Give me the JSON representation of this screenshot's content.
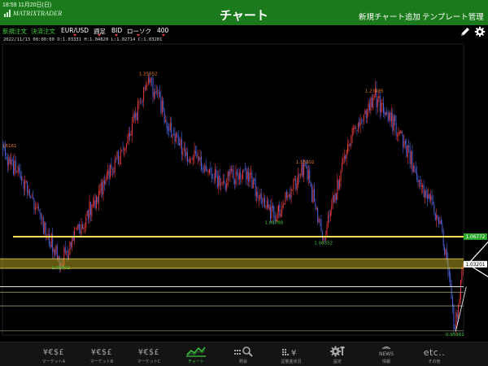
{
  "status_bar": {
    "time": "18:59",
    "date": "11月20日(日)"
  },
  "header": {
    "logo_text": "MATRIXTRADER",
    "title": "チャート",
    "new_chart_label": "新規チャート追加",
    "template_label": "テンプレート管理"
  },
  "toolbar": {
    "new_order_label": "新規注文",
    "settle_order_label": "決済注文",
    "symbol": "EUR/USD",
    "timeframe": "週足",
    "price_side": "BID",
    "chart_type": "ローソク",
    "bar_count": "400",
    "pencil_icon": "pencil-icon",
    "gear_icon": "gear-icon"
  },
  "ohlc_readout": {
    "datetime": "2022/11/13 00:00:00",
    "open": "O:1.03331",
    "high": "H:1.04820",
    "low": "L:1.02714",
    "close": "C:1.03201"
  },
  "chart_data": {
    "type": "candlestick",
    "symbol": "EUR/USD",
    "timeframe": "週足",
    "bar_count": 400,
    "ylim": [
      0.947,
      1.296
    ],
    "bull_color": "#e83a3a",
    "bear_color": "#4a64d8",
    "swing_points": [
      {
        "i": 0,
        "price": 1.17,
        "label": ""
      },
      {
        "i": 22,
        "price": 1.12,
        "label": ""
      },
      {
        "i": 50,
        "price": 1.034,
        "label": "1.03402"
      },
      {
        "i": 68,
        "price": 1.08,
        "label": ""
      },
      {
        "i": 108,
        "price": 1.18,
        "label": ""
      },
      {
        "i": 126,
        "price": 1.2555,
        "label": "1.25552"
      },
      {
        "i": 152,
        "price": 1.175,
        "label": ""
      },
      {
        "i": 190,
        "price": 1.13,
        "label": ""
      },
      {
        "i": 210,
        "price": 1.145,
        "label": ""
      },
      {
        "i": 235,
        "price": 1.0879,
        "label": "1.08788"
      },
      {
        "i": 262,
        "price": 1.15,
        "label": "1.15002"
      },
      {
        "i": 278,
        "price": 1.0634,
        "label": "1.06352"
      },
      {
        "i": 302,
        "price": 1.185,
        "label": ""
      },
      {
        "i": 322,
        "price": 1.235,
        "label": "1.23495"
      },
      {
        "i": 343,
        "price": 1.19,
        "label": ""
      },
      {
        "i": 366,
        "price": 1.12,
        "label": ""
      },
      {
        "i": 380,
        "price": 1.08,
        "label": ""
      },
      {
        "i": 386,
        "price": 1.025,
        "label": ""
      },
      {
        "i": 392,
        "price": 0.9536,
        "label": "0.95361"
      },
      {
        "i": 399,
        "price": 1.032,
        "label": ""
      }
    ],
    "left_edge_label": {
      "price": 1.17,
      "text": "16161"
    },
    "hlines": [
      {
        "price": 1.065,
        "color": "#f2dc5a",
        "width": 2
      },
      {
        "price": 1.0337,
        "color": "#b4a020",
        "band": [
          1.027,
          1.0385
        ]
      },
      {
        "price": 1.005,
        "color": "#e2e2e2",
        "width": 1
      },
      {
        "price": 0.9985,
        "color": "#d8d0a0",
        "width": 0.6
      },
      {
        "price": 0.982,
        "color": "#d8d0a0",
        "width": 0.6
      },
      {
        "price": 0.952,
        "color": "#c8c0a0",
        "width": 0.6
      }
    ],
    "price_tags": [
      {
        "price": 1.065,
        "text": "1.06772",
        "bg": "#2aa82a",
        "fg": "#ffffff"
      },
      {
        "price": 1.032,
        "text": "1.03201",
        "bg": "#ffffff",
        "fg": "#000000"
      }
    ]
  },
  "bottom_nav": [
    {
      "icon": "¥€$£",
      "label": "マーケットA",
      "active": false
    },
    {
      "icon": "¥€$£",
      "label": "マーケットB",
      "active": false
    },
    {
      "icon": "¥€$£",
      "label": "マーケットC",
      "active": false
    },
    {
      "icon": "chart-icon",
      "label": "チャート",
      "active": true
    },
    {
      "icon": "search-icon",
      "label": "照会",
      "active": false
    },
    {
      "icon": "margin-icon",
      "label": "証拠金状況",
      "active": false
    },
    {
      "icon": "settings-icon",
      "label": "設定",
      "active": false
    },
    {
      "icon": "NEWS",
      "label": "情報",
      "active": false
    },
    {
      "icon": "etc..",
      "label": "その他",
      "active": false
    }
  ]
}
